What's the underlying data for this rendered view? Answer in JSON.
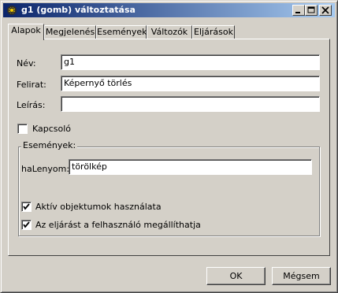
{
  "window": {
    "title": "g1 (gomb) változtatása",
    "controls": [
      "minimize-icon",
      "maximize-icon",
      "close-icon"
    ]
  },
  "tabs": [
    {
      "label": "Alapok",
      "active": true
    },
    {
      "label": "Megjelenés",
      "active": false
    },
    {
      "label": "Események",
      "active": false
    },
    {
      "label": "Változók",
      "active": false
    },
    {
      "label": "Eljárások",
      "active": false
    }
  ],
  "form": {
    "name_label": "Név:",
    "name_value": "g1",
    "caption_label": "Felirat:",
    "caption_value": "Képernyő törlés",
    "description_label": "Leírás:",
    "description_value": "",
    "switch_label": "Kapcsoló",
    "switch_checked": false
  },
  "events": {
    "group_title": "Események:",
    "onclick_label": "haLenyom:",
    "onclick_value": "törölkép",
    "active_objects_label": "Aktív objektumok használata",
    "active_objects_checked": true,
    "user_stop_label": "Az eljárást a felhasználó megállíthatja",
    "user_stop_checked": true
  },
  "buttons": {
    "ok": "OK",
    "cancel": "Mégsem"
  }
}
